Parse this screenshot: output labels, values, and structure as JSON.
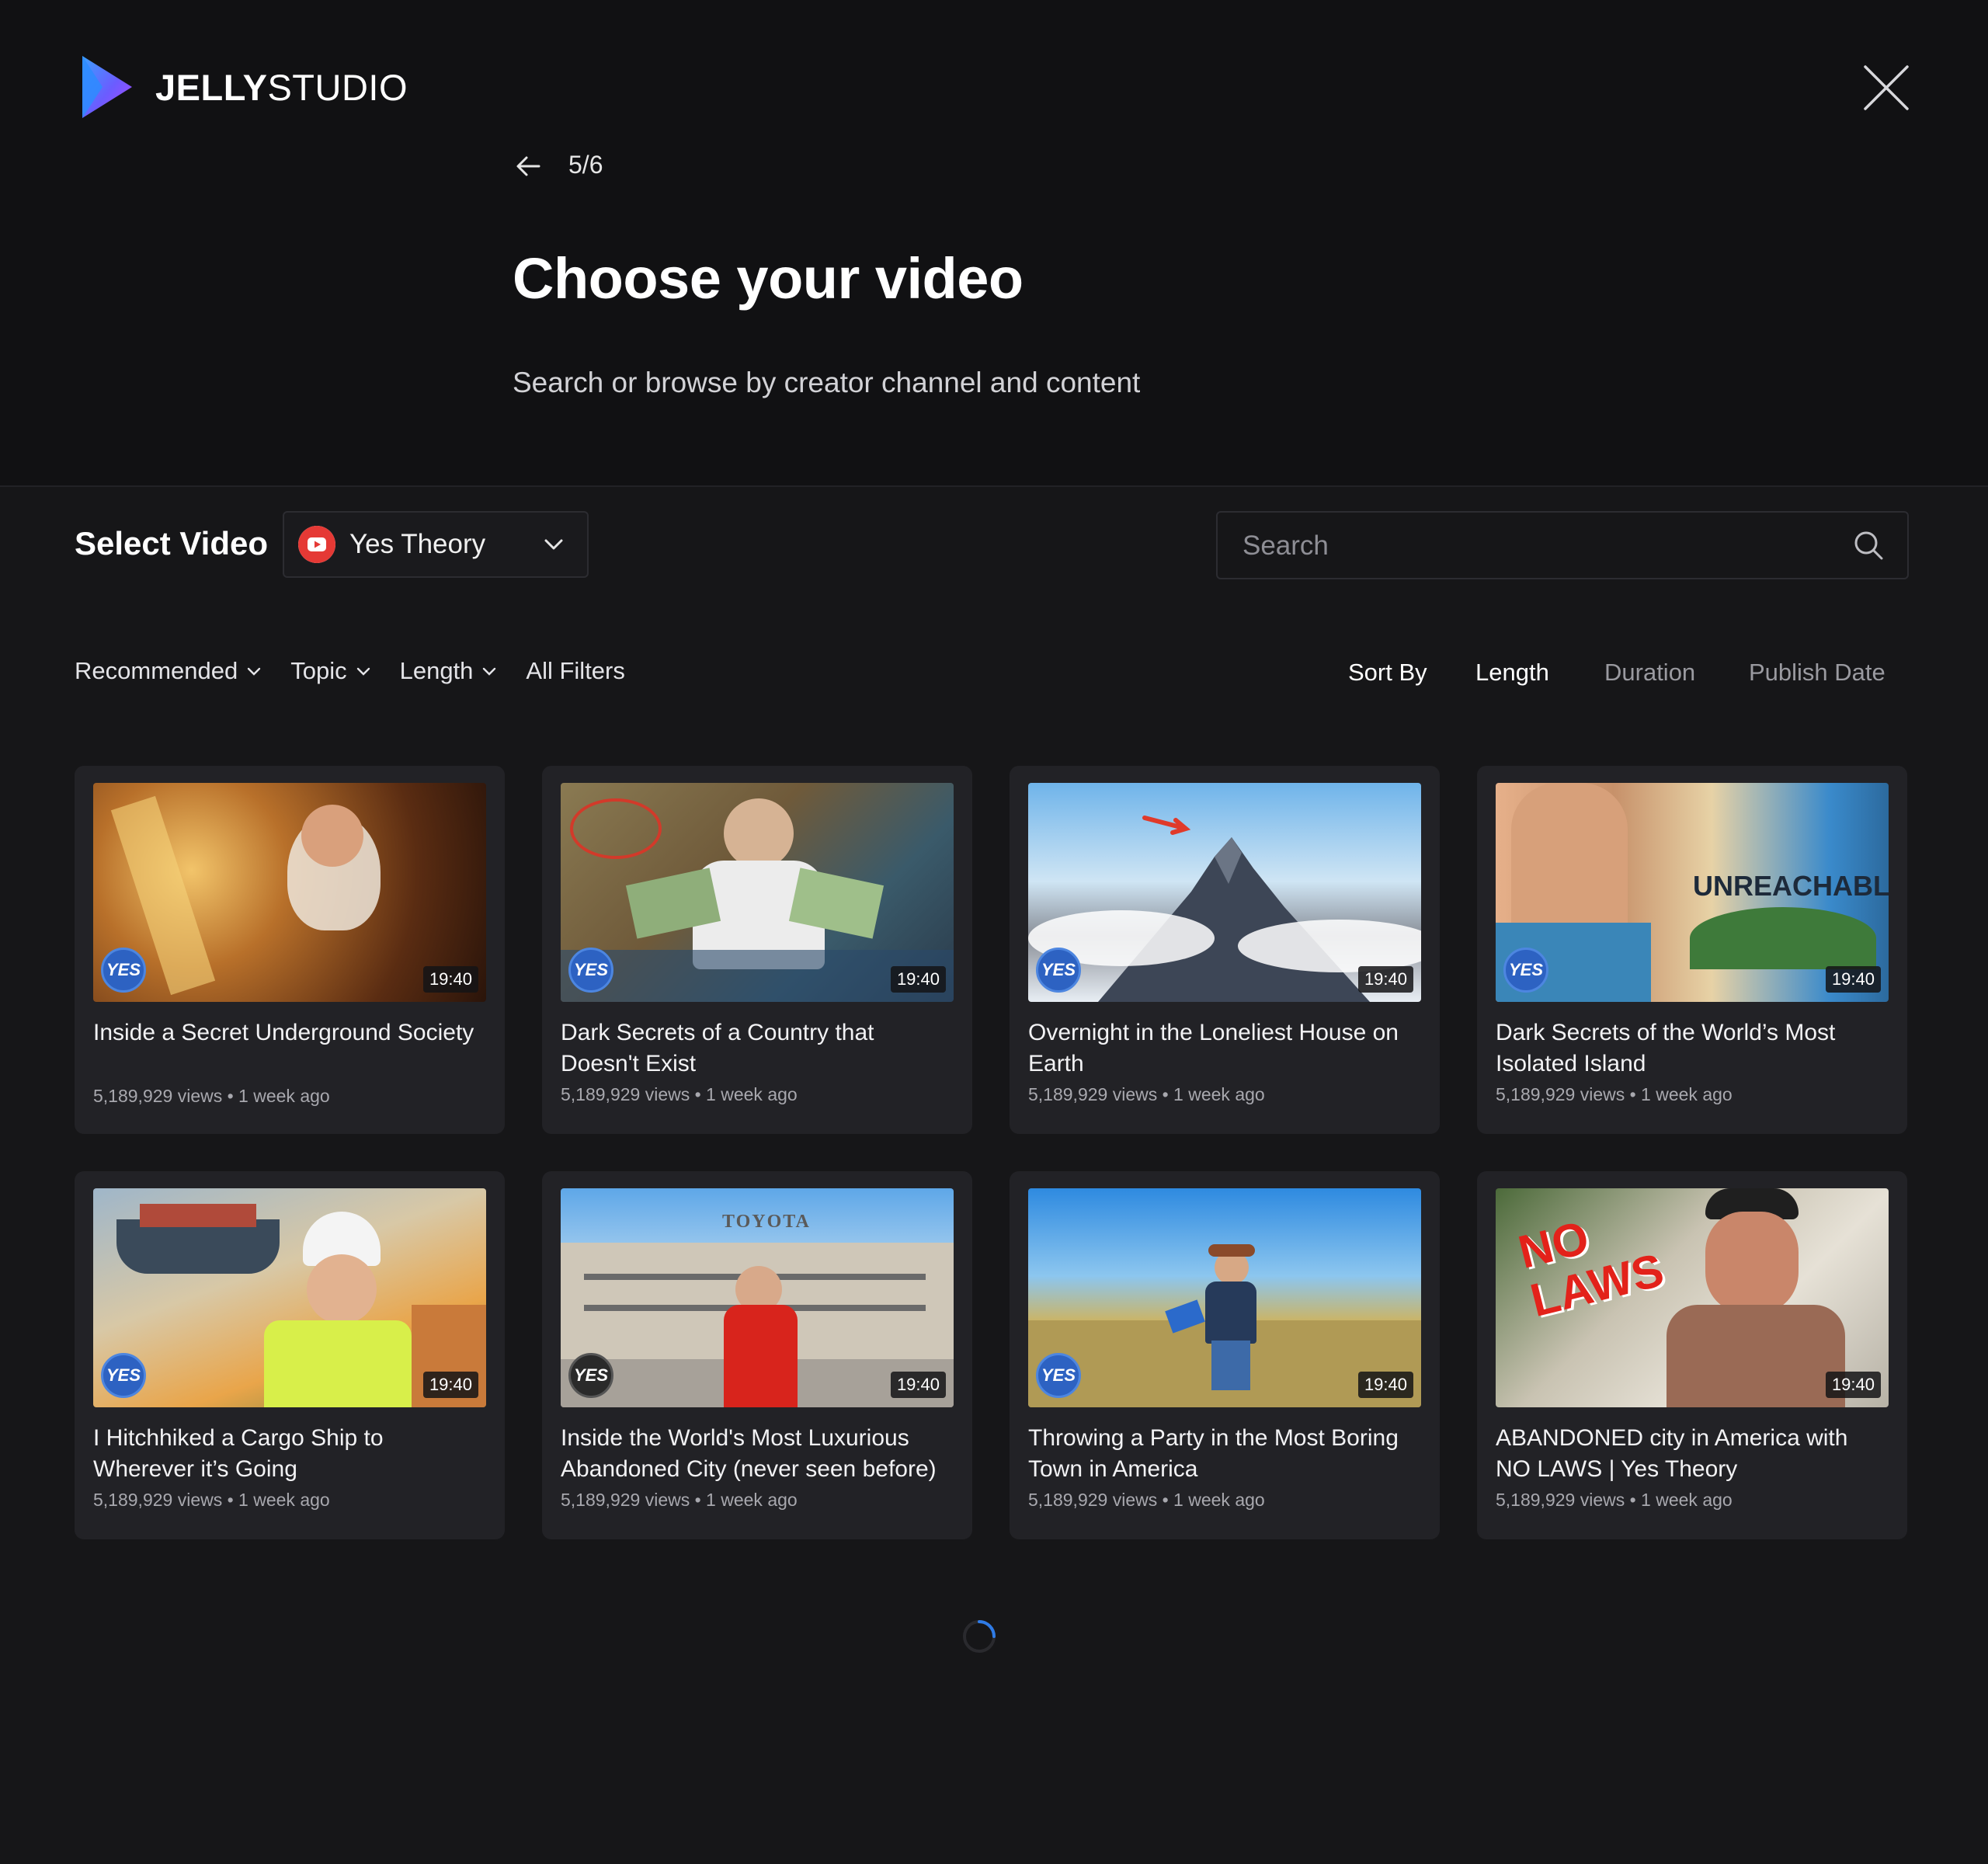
{
  "brand": {
    "name_bold": "JELLY",
    "name_light": "STUDIO"
  },
  "wizard": {
    "step": "5/6",
    "title": "Choose your video",
    "subtitle": "Search or browse by creator channel and content"
  },
  "selector": {
    "label": "Select Video",
    "channel": "Yes Theory"
  },
  "search": {
    "placeholder": "Search",
    "value": ""
  },
  "filters": [
    "Recommended",
    "Topic",
    "Length",
    "All Filters"
  ],
  "sort": {
    "label": "Sort By",
    "options": [
      {
        "label": "Length",
        "active": true
      },
      {
        "label": "Duration",
        "active": false
      },
      {
        "label": "Publish Date",
        "active": false
      }
    ]
  },
  "videos": [
    {
      "title": "Inside a Secret Underground Society",
      "meta": "5,189,929 views • 1 week ago",
      "duration": "19:40",
      "badge": "YES"
    },
    {
      "title": "Dark Secrets of a Country that Doesn't Exist",
      "meta": "5,189,929 views • 1 week ago",
      "duration": "19:40",
      "badge": "YES"
    },
    {
      "title": "Overnight in the Loneliest House on Earth",
      "meta": "5,189,929 views • 1 week ago",
      "duration": "19:40",
      "badge": "YES"
    },
    {
      "title": "Dark Secrets of the World’s Most Isolated Island",
      "meta": "5,189,929 views • 1 week ago",
      "duration": "19:40",
      "badge": "YES",
      "overlay_text": "UNREACHABLE"
    },
    {
      "title": "I Hitchhiked a Cargo Ship to Wherever it’s Going",
      "meta": "5,189,929 views • 1 week ago",
      "duration": "19:40",
      "badge": "YES"
    },
    {
      "title": "Inside the World's Most Luxurious Abandoned City (never seen before)",
      "meta": "5,189,929 views • 1 week ago",
      "duration": "19:40",
      "badge": "YES",
      "overlay_text": "TOYOTA"
    },
    {
      "title": "Throwing a Party in the Most Boring Town in America",
      "meta": "5,189,929 views • 1 week ago",
      "duration": "19:40",
      "badge": "YES"
    },
    {
      "title": "ABANDONED city in America with NO LAWS | Yes Theory",
      "meta": "5,189,929 views • 1 week ago",
      "duration": "19:40",
      "badge": "YES",
      "overlay_text": "NO LAWS"
    }
  ],
  "colors": {
    "accent": "#2f7be6",
    "background": "#161618",
    "card": "#222226",
    "youtube": "#e53935"
  }
}
